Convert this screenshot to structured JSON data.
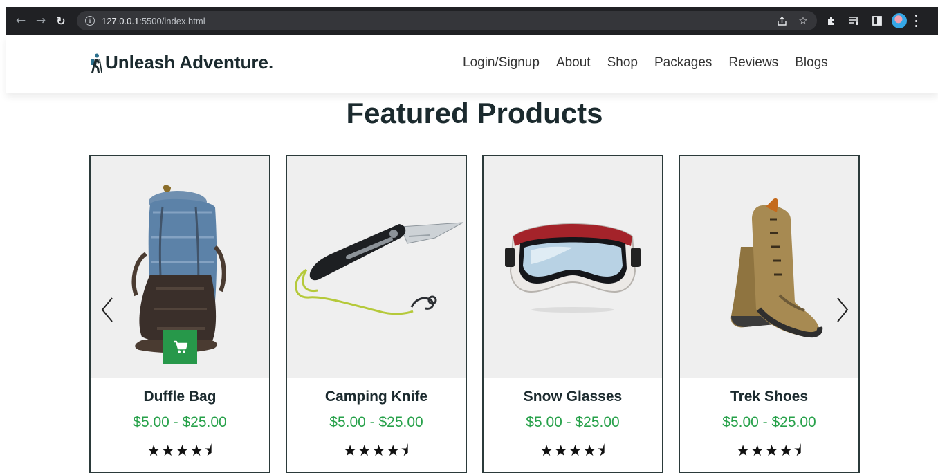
{
  "browser": {
    "url_host": "127.0.0.1",
    "url_rest": ":5500/index.html"
  },
  "header": {
    "brand": "Unleash Adventure.",
    "nav": [
      "Login/Signup",
      "About",
      "Shop",
      "Packages",
      "Reviews",
      "Blogs"
    ]
  },
  "section": {
    "title": "Featured Products"
  },
  "products": [
    {
      "name": "Duffle Bag",
      "price": "$5.00 - $25.00",
      "rating": 4.5,
      "image": "backpack"
    },
    {
      "name": "Camping Knife",
      "price": "$5.00 - $25.00",
      "rating": 4.5,
      "image": "folding-knife"
    },
    {
      "name": "Snow Glasses",
      "price": "$5.00 - $25.00",
      "rating": 4.5,
      "image": "ski-goggles"
    },
    {
      "name": "Trek Shoes",
      "price": "$5.00 - $25.00",
      "rating": 4.5,
      "image": "hiking-boots"
    }
  ],
  "colors": {
    "accent_green": "#27a14a",
    "cart_green": "#27984a",
    "heading": "#1b2a2e",
    "card_border": "#2b3a3a",
    "image_bg": "#efefef"
  },
  "icons": [
    "back-icon",
    "forward-icon",
    "reload-icon",
    "info-icon",
    "share-icon",
    "star-icon",
    "extensions-icon",
    "reading-list-icon",
    "side-panel-icon",
    "profile-avatar",
    "menu-icon",
    "hiker-icon",
    "cart-icon",
    "chevron-left-icon",
    "chevron-right-icon"
  ]
}
